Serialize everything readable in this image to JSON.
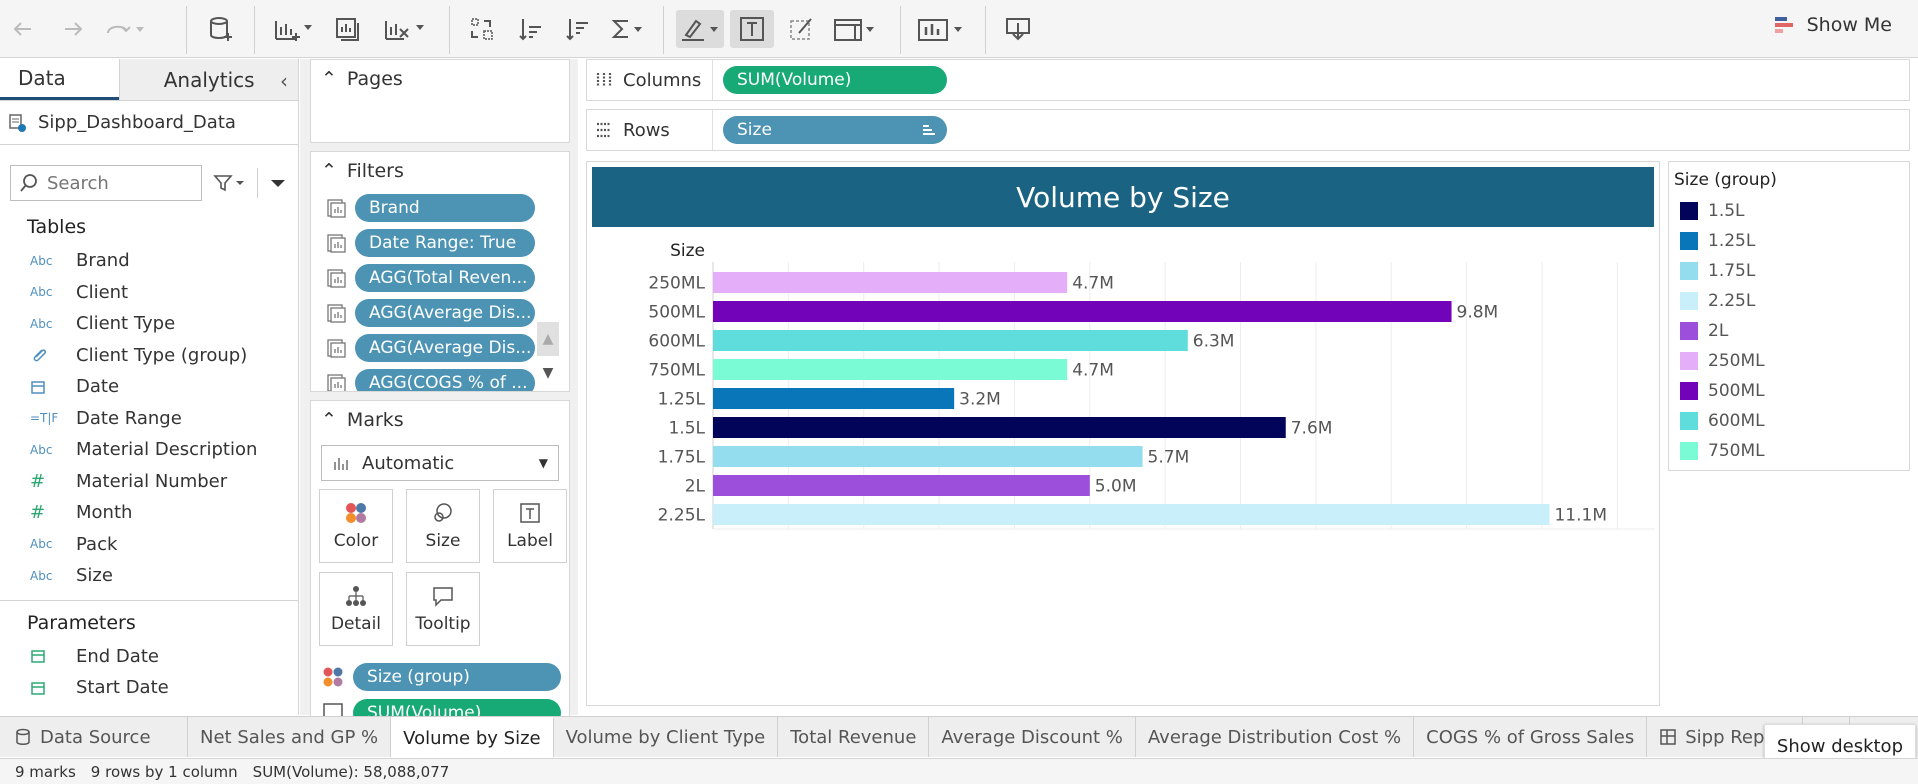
{
  "toolbar": {
    "show_me_label": "Show Me"
  },
  "data_pane": {
    "tabs": [
      "Data",
      "Analytics"
    ],
    "datasource": "Sipp_Dashboard_Data",
    "search_placeholder": "Search",
    "tables_heading": "Tables",
    "fields": [
      {
        "type": "Abc",
        "name": "Brand"
      },
      {
        "type": "Abc",
        "name": "Client"
      },
      {
        "type": "Abc",
        "name": "Client Type"
      },
      {
        "type": "paperclip",
        "name": "Client Type (group)"
      },
      {
        "type": "calendar",
        "name": "Date"
      },
      {
        "type": "T|F",
        "name": "Date Range"
      },
      {
        "type": "Abc",
        "name": "Material Description"
      },
      {
        "type": "#",
        "name": "Material Number"
      },
      {
        "type": "#",
        "name": "Month"
      },
      {
        "type": "Abc",
        "name": "Pack"
      },
      {
        "type": "Abc",
        "name": "Size"
      }
    ],
    "parameters_heading": "Parameters",
    "parameters": [
      "End Date",
      "Start Date"
    ]
  },
  "cards": {
    "pages_title": "Pages",
    "filters_title": "Filters",
    "filters": [
      "Brand",
      "Date Range: True",
      "AGG(Total Reven...",
      "AGG(Average Dis...",
      "AGG(Average Dis...",
      "AGG(COGS % of ..."
    ],
    "marks_title": "Marks",
    "mark_type": "Automatic",
    "mark_buttons": [
      "Color",
      "Size",
      "Label",
      "Detail",
      "Tooltip"
    ],
    "mark_pills": [
      "Size (group)",
      "SUM(Volume)"
    ]
  },
  "shelves": {
    "columns_label": "Columns",
    "columns_pill": "SUM(Volume)",
    "rows_label": "Rows",
    "rows_pill": "Size"
  },
  "viz": {
    "title": "Volume by Size"
  },
  "chart_data": {
    "type": "bar",
    "orientation": "horizontal",
    "title": "Volume by Size",
    "row_header": "Size",
    "categories": [
      "250ML",
      "500ML",
      "600ML",
      "750ML",
      "1.25L",
      "1.5L",
      "1.75L",
      "2L",
      "2.25L"
    ],
    "values": [
      4.7,
      9.8,
      6.3,
      4.7,
      3.2,
      7.6,
      5.7,
      5.0,
      11.1
    ],
    "value_unit": "M",
    "data_labels": [
      "4.7M",
      "9.8M",
      "6.3M",
      "4.7M",
      "3.2M",
      "7.6M",
      "5.7M",
      "5.0M",
      "11.1M"
    ],
    "colors": [
      "#e5aef8",
      "#7303b9",
      "#5fdcdc",
      "#7bfad6",
      "#0876b8",
      "#010458",
      "#93ddef",
      "#9b4fdb",
      "#c9effa"
    ],
    "xlim": [
      0,
      12.5
    ],
    "grid": true
  },
  "legend": {
    "title": "Size (group)",
    "items": [
      {
        "label": "1.5L",
        "color": "#010458"
      },
      {
        "label": "1.25L",
        "color": "#0876b8"
      },
      {
        "label": "1.75L",
        "color": "#93ddef"
      },
      {
        "label": "2.25L",
        "color": "#c9effa"
      },
      {
        "label": "2L",
        "color": "#9b4fdb"
      },
      {
        "label": "250ML",
        "color": "#e5aef8"
      },
      {
        "label": "500ML",
        "color": "#7303b9"
      },
      {
        "label": "600ML",
        "color": "#5fdcdc"
      },
      {
        "label": "750ML",
        "color": "#7bfad6"
      }
    ]
  },
  "sheet_tabs": {
    "data_source": "Data Source",
    "tabs": [
      "Net Sales and GP %",
      "Volume by Size",
      "Volume by Client Type",
      "Total Revenue",
      "Average Discount %",
      "Average Distribution Cost %",
      "COGS % of Gross Sales",
      "Sipp Report"
    ],
    "active": "Volume by Size",
    "show_desktop": "Show desktop"
  },
  "status": {
    "marks": "9 marks",
    "rows": "9 rows by 1 column",
    "sum": "SUM(Volume): 58,088,077"
  }
}
